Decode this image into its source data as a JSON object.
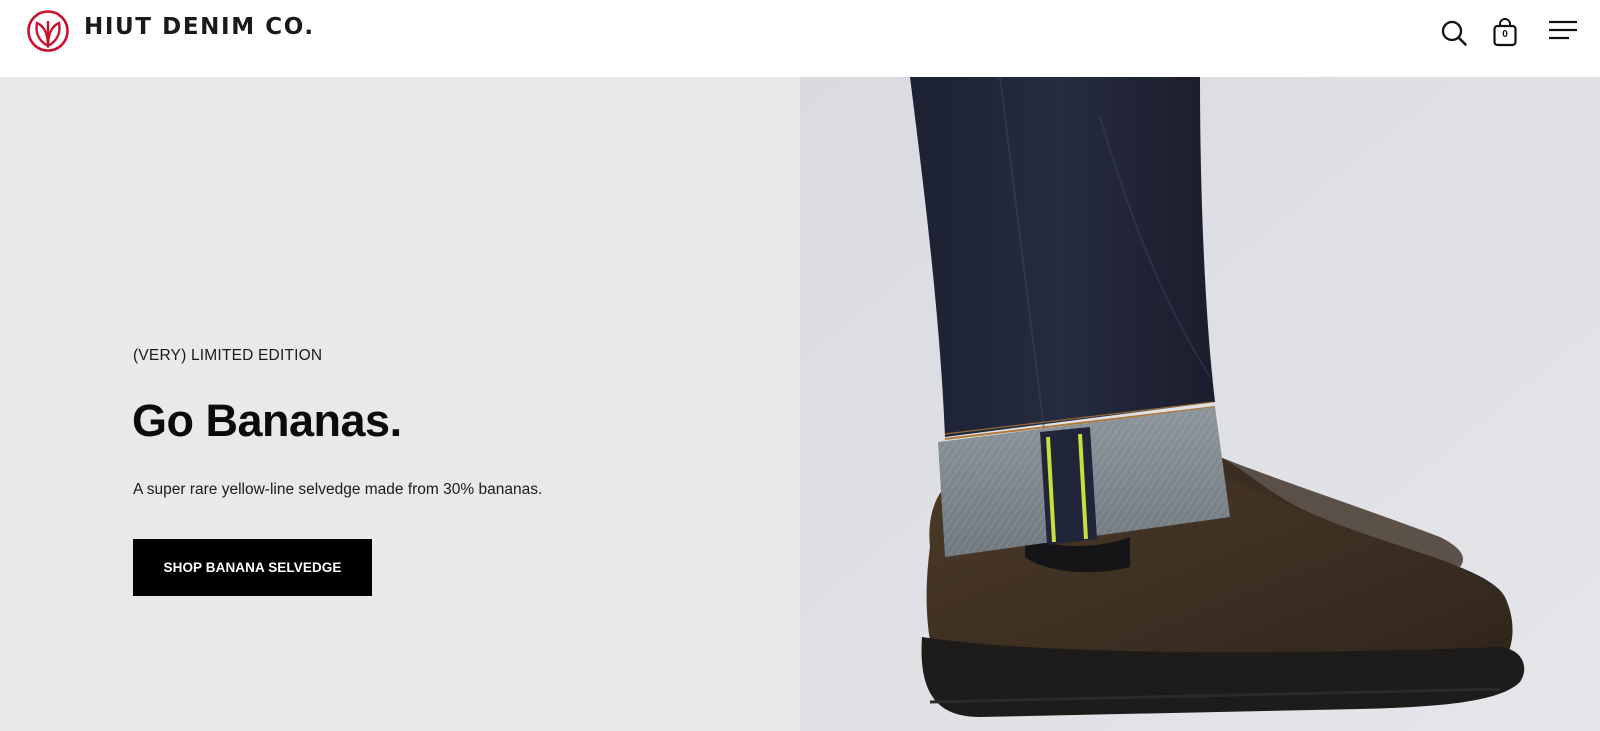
{
  "header": {
    "brand_name": "HIUT DENIM CO.",
    "icons": {
      "logo": "hiut-leaf-logo",
      "search": "search-icon",
      "cart": "shopping-bag-icon",
      "menu": "hamburger-menu-icon"
    },
    "cart_count": "0",
    "brand_color": "#c8102e"
  },
  "hero": {
    "eyebrow": "(VERY) LIMITED EDITION",
    "title": "Go Bananas.",
    "description": "A super rare yellow-line selvedge made from 30% bananas.",
    "cta_label": "SHOP BANANA SELVEDGE",
    "image_subject": "raw-denim-jeans-turned-up-with-yellow-selvedge-and-brown-leather-boot",
    "colors": {
      "left_panel": "#e9e9eb",
      "cta_bg": "#000000",
      "selvedge_line": "#c7e03a"
    }
  }
}
